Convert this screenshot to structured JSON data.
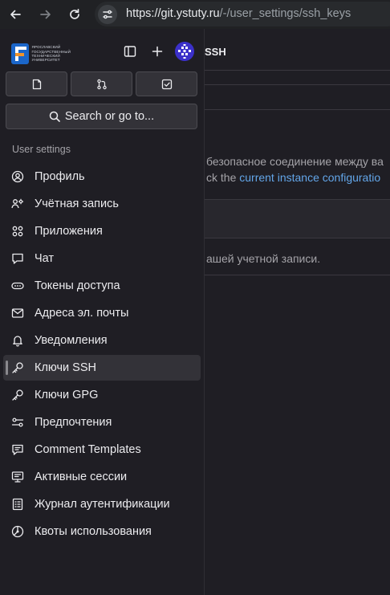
{
  "browser": {
    "url_host": "https://git.ystuty.ru",
    "url_path": "/-/user_settings/ssh_keys"
  },
  "logo": {
    "text_lines": [
      "ЯРОСЛАВСКИЙ",
      "ГОСУДАРСТВЕННЫЙ",
      "ТЕХНИЧЕСКИЙ",
      "УНИВЕРСИТЕТ"
    ]
  },
  "main": {
    "breadcrumb": "SSH",
    "description_line1": "безопасное соединение между ва",
    "description_line2_prefix": "ck the ",
    "description_line2_link": "current instance configuratio",
    "empty_text": "ашей учетной записи."
  },
  "sidebar": {
    "search_label": "Search or go to...",
    "section_title": "User settings",
    "items": [
      {
        "label": "Профиль",
        "icon": "profile-icon"
      },
      {
        "label": "Учётная запись",
        "icon": "account-icon"
      },
      {
        "label": "Приложения",
        "icon": "applications-icon"
      },
      {
        "label": "Чат",
        "icon": "chat-icon"
      },
      {
        "label": "Токены доступа",
        "icon": "token-icon"
      },
      {
        "label": "Адреса эл. почты",
        "icon": "mail-icon"
      },
      {
        "label": "Уведомления",
        "icon": "bell-icon"
      },
      {
        "label": "Ключи SSH",
        "icon": "key-icon",
        "active": true
      },
      {
        "label": "Ключи GPG",
        "icon": "key-icon"
      },
      {
        "label": "Предпочтения",
        "icon": "preferences-icon"
      },
      {
        "label": "Comment Templates",
        "icon": "comment-icon"
      },
      {
        "label": "Активные сессии",
        "icon": "monitor-icon"
      },
      {
        "label": "Журнал аутентификации",
        "icon": "log-icon"
      },
      {
        "label": "Квоты использования",
        "icon": "quota-icon"
      }
    ]
  },
  "colors": {
    "background": "#1f1e24",
    "active_item": "#333238",
    "link": "#63a6e9",
    "logo_blue": "#1b66c9",
    "logo_orange": "#f0932b"
  }
}
